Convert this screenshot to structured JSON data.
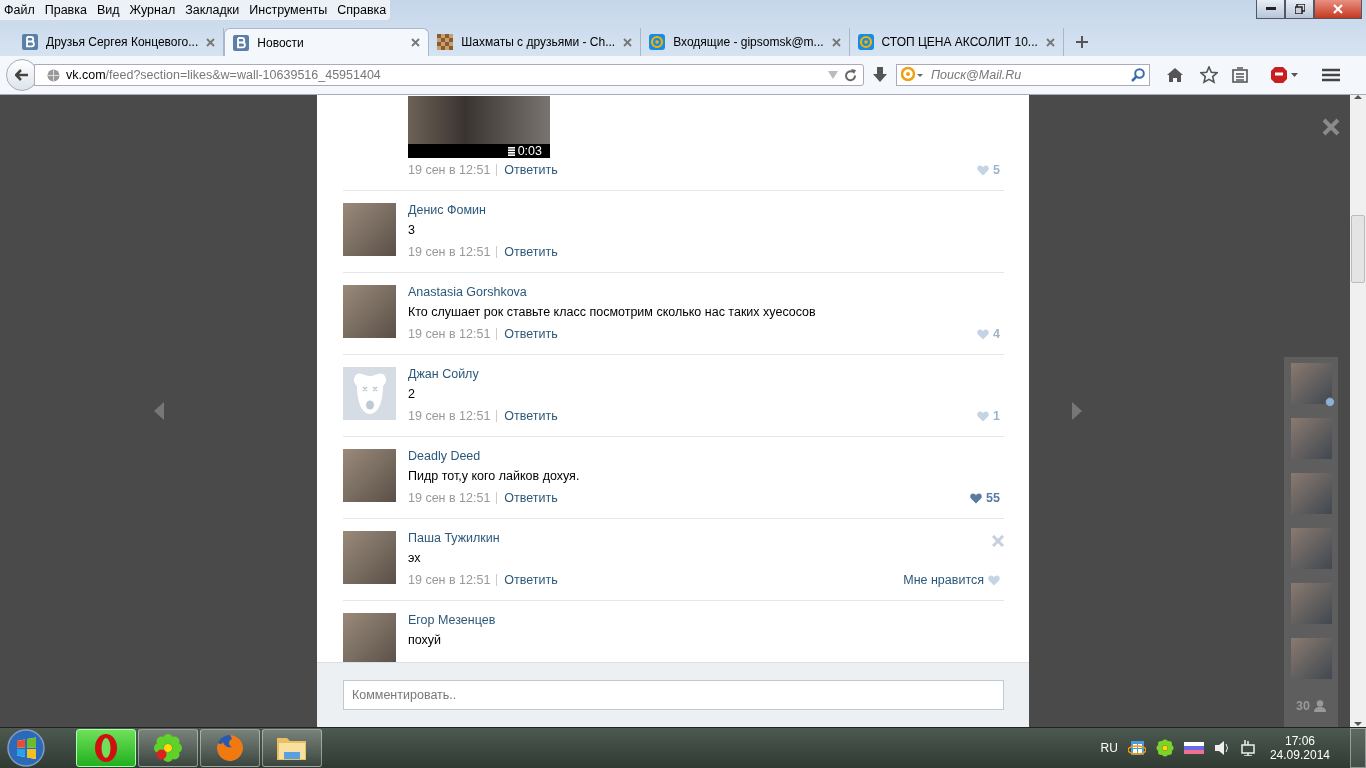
{
  "menu": [
    "Файл",
    "Правка",
    "Вид",
    "Журнал",
    "Закладки",
    "Инструменты",
    "Справка"
  ],
  "tabs": [
    {
      "label": "Друзья Сергея Концевого...",
      "selected": false,
      "kind": "vk"
    },
    {
      "label": "Новости",
      "selected": true,
      "kind": "vk"
    },
    {
      "label": "Шахматы с друзьями - Ch...",
      "selected": false,
      "kind": "chess"
    },
    {
      "label": "Входящие - gipsomsk@m...",
      "selected": false,
      "kind": "mail"
    },
    {
      "label": "СТОП ЦЕНА АКСОЛИТ 10...",
      "selected": false,
      "kind": "mail"
    }
  ],
  "address": {
    "host": "vk.com",
    "path": "/feed?section=likes&w=wall-10639516_45951404"
  },
  "search": {
    "placeholder": "Поиск@Mail.Ru"
  },
  "comments": [
    {
      "kind": "video",
      "duration": "0:03",
      "date": "19 сен в 12:51",
      "reply": "Ответить",
      "like": {
        "kind": "count",
        "count": "5",
        "liked": false
      }
    },
    {
      "kind": "text",
      "author": "Денис Фомин",
      "default_avatar": false,
      "text": "3",
      "date": "19 сен в 12:51",
      "reply": "Ответить"
    },
    {
      "kind": "text",
      "author": "Anastasia Gorshkova",
      "default_avatar": false,
      "text": "Кто слушает рок ставьте класс посмотрим сколько нас таких хуесосов",
      "date": "19 сен в 12:51",
      "reply": "Ответить",
      "like": {
        "kind": "count",
        "count": "4",
        "liked": false
      }
    },
    {
      "kind": "text",
      "author": "Джан Сойлу",
      "default_avatar": true,
      "text": "2",
      "date": "19 сен в 12:51",
      "reply": "Ответить",
      "like": {
        "kind": "count",
        "count": "1",
        "liked": false
      }
    },
    {
      "kind": "text",
      "author": "Deadly Deed",
      "default_avatar": false,
      "text": "Пидр тот,у кого лайков дохуя.",
      "date": "19 сен в 12:51",
      "reply": "Ответить",
      "like": {
        "kind": "count",
        "count": "55",
        "liked": true
      }
    },
    {
      "kind": "text",
      "author": "Паша Тужилкин",
      "default_avatar": false,
      "text": "эх",
      "date": "19 сен в 12:51",
      "reply": "Ответить",
      "deletable": true,
      "like": {
        "kind": "label",
        "label": "Мне нравится",
        "liked": false
      }
    },
    {
      "kind": "text",
      "author": "Егор Мезенцев",
      "default_avatar": false,
      "text": "похуй"
    }
  ],
  "comment_field": {
    "placeholder": "Комментировать.."
  },
  "likers": {
    "avatars": [
      {
        "online": true
      },
      {
        "online": false
      },
      {
        "online": false
      },
      {
        "online": false
      },
      {
        "online": false
      },
      {
        "online": false
      }
    ],
    "count": "30"
  },
  "taskbar": {
    "apps": [
      {
        "kind": "opera",
        "active": true
      },
      {
        "kind": "icq",
        "active": false
      },
      {
        "kind": "firefox",
        "active": false
      },
      {
        "kind": "explorer",
        "active": false
      }
    ],
    "language": "RU",
    "time": "17:06",
    "date": "24.09.2014"
  }
}
